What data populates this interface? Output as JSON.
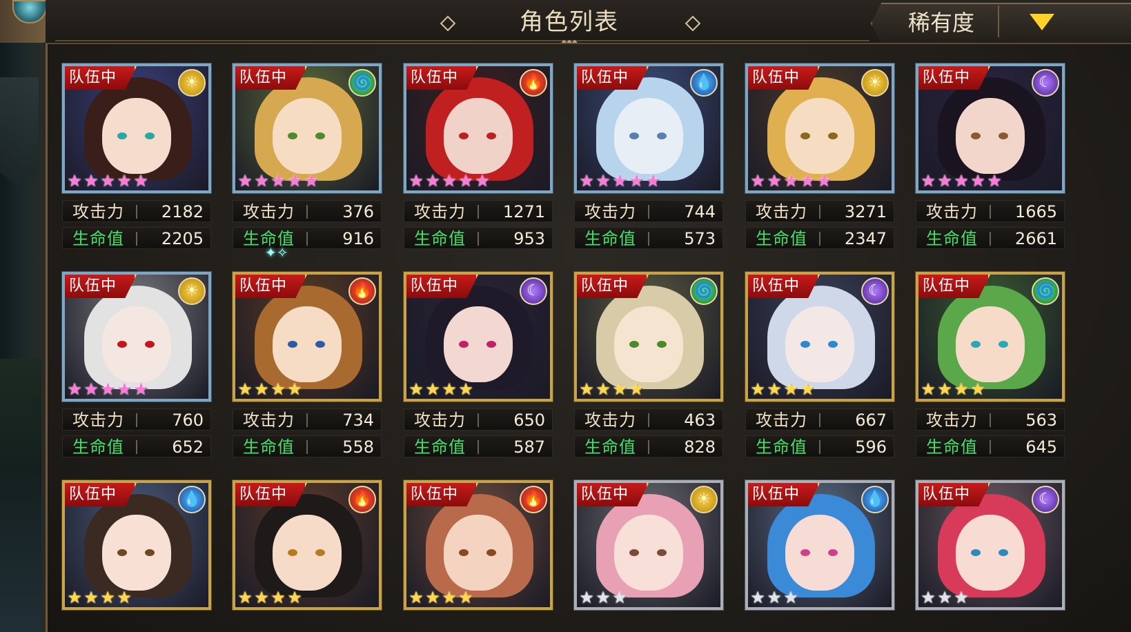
{
  "header": {
    "title": "角色列表",
    "sort_label": "稀有度"
  },
  "team_badge_text": "队伍中",
  "stat_labels": {
    "attack": "攻击力",
    "hp": "生命值"
  },
  "element_icons": {
    "sun": "☀",
    "fire": "🔥",
    "water": "💧",
    "wind": "🌀",
    "moon": "☾"
  },
  "rows": [
    {
      "cards": [
        {
          "element": "sun",
          "stars": 5,
          "star_style": "rainbow",
          "frame": "blue",
          "attack": "2182",
          "hp": "2205",
          "hair": "#3a1e1a",
          "skin": "#f6dccc",
          "eye": "#2aa7a0",
          "bg": "#3a3f7a"
        },
        {
          "element": "wind",
          "stars": 5,
          "star_style": "rainbow",
          "frame": "blue",
          "attack": "376",
          "hp": "916",
          "hair": "#d6a850",
          "skin": "#f7dcc4",
          "eye": "#4c8a2a",
          "bg": "#5b6a3a"
        },
        {
          "element": "fire",
          "stars": 5,
          "star_style": "rainbow",
          "frame": "blue",
          "attack": "1271",
          "hp": "953",
          "hair": "#c02020",
          "skin": "#f1d2c8",
          "eye": "#b22",
          "bg": "#3a2020"
        },
        {
          "element": "water",
          "stars": 5,
          "star_style": "rainbow",
          "frame": "blue",
          "attack": "744",
          "hp": "573",
          "hair": "#b8d4ec",
          "skin": "#e8eef6",
          "eye": "#5a7fb0",
          "bg": "#3c4c7a"
        },
        {
          "element": "sun",
          "stars": 5,
          "star_style": "rainbow",
          "frame": "blue",
          "attack": "3271",
          "hp": "2347",
          "hair": "#e0b050",
          "skin": "#f6dcc0",
          "eye": "#8a6a20",
          "bg": "#4a3a2a"
        },
        {
          "element": "moon",
          "stars": 5,
          "star_style": "rainbow",
          "frame": "blue",
          "attack": "1665",
          "hp": "2661",
          "hair": "#1a1420",
          "skin": "#f2d6cc",
          "eye": "#8a5a30",
          "bg": "#2a2440"
        }
      ]
    },
    {
      "cards": [
        {
          "element": "sun",
          "stars": 5,
          "star_style": "rainbow",
          "frame": "blue",
          "attack": "760",
          "hp": "652",
          "hair": "#e2e2e2",
          "skin": "#f4e6e0",
          "eye": "#c01818",
          "bg": "#7a7a80"
        },
        {
          "element": "fire",
          "stars": 4,
          "star_style": "gold",
          "frame": "gold",
          "attack": "734",
          "hp": "558",
          "hair": "#a86a2e",
          "skin": "#f6dcc4",
          "eye": "#2a5aa8",
          "bg": "#5a3a22"
        },
        {
          "element": "moon",
          "stars": 4,
          "star_style": "gold",
          "frame": "gold",
          "attack": "650",
          "hp": "587",
          "hair": "#1e1a2a",
          "skin": "#f2d8d0",
          "eye": "#c0206a",
          "bg": "#2a2436"
        },
        {
          "element": "wind",
          "stars": 4,
          "star_style": "gold",
          "frame": "gold",
          "attack": "463",
          "hp": "828",
          "hair": "#d8cca8",
          "skin": "#f4e4d0",
          "eye": "#4a8a2a",
          "bg": "#5a5a40"
        },
        {
          "element": "moon",
          "stars": 4,
          "star_style": "gold",
          "frame": "gold",
          "attack": "667",
          "hp": "596",
          "hair": "#cfd8e8",
          "skin": "#f4e8e6",
          "eye": "#2a8ad0",
          "bg": "#3a4058"
        },
        {
          "element": "wind",
          "stars": 4,
          "star_style": "gold",
          "frame": "gold",
          "attack": "563",
          "hp": "645",
          "hair": "#5aa84a",
          "skin": "#f6dcc8",
          "eye": "#2aa8b8",
          "bg": "#3a5a30"
        }
      ]
    },
    {
      "cards": [
        {
          "element": "water",
          "stars": 4,
          "star_style": "gold",
          "frame": "gold",
          "hair": "#3a2a22",
          "skin": "#f8e0d4",
          "eye": "#6a4a20",
          "bg": "#4a5a7a"
        },
        {
          "element": "fire",
          "stars": 4,
          "star_style": "gold",
          "frame": "gold",
          "hair": "#1e1a1a",
          "skin": "#f6dcc8",
          "eye": "#b87a20",
          "bg": "#5a3a2a"
        },
        {
          "element": "fire",
          "stars": 4,
          "star_style": "gold",
          "frame": "gold",
          "hair": "#b86a4a",
          "skin": "#f4d4c0",
          "eye": "#8a4a20",
          "bg": "#6a4a3a"
        },
        {
          "element": "sun",
          "stars": 3,
          "star_style": "silver",
          "frame": "silver",
          "hair": "#e8a0b4",
          "skin": "#f8e0d8",
          "eye": "#7a4a3a",
          "bg": "#6a6a70"
        },
        {
          "element": "water",
          "stars": 3,
          "star_style": "silver",
          "frame": "silver",
          "hair": "#3a8ad8",
          "skin": "#f6dcd4",
          "eye": "#d0408a",
          "bg": "#5a6a80"
        },
        {
          "element": "moon",
          "stars": 3,
          "star_style": "silver",
          "frame": "silver",
          "hair": "#d83a5a",
          "skin": "#f8dcd4",
          "eye": "#2a8ab8",
          "bg": "#6a5a60"
        }
      ]
    }
  ]
}
